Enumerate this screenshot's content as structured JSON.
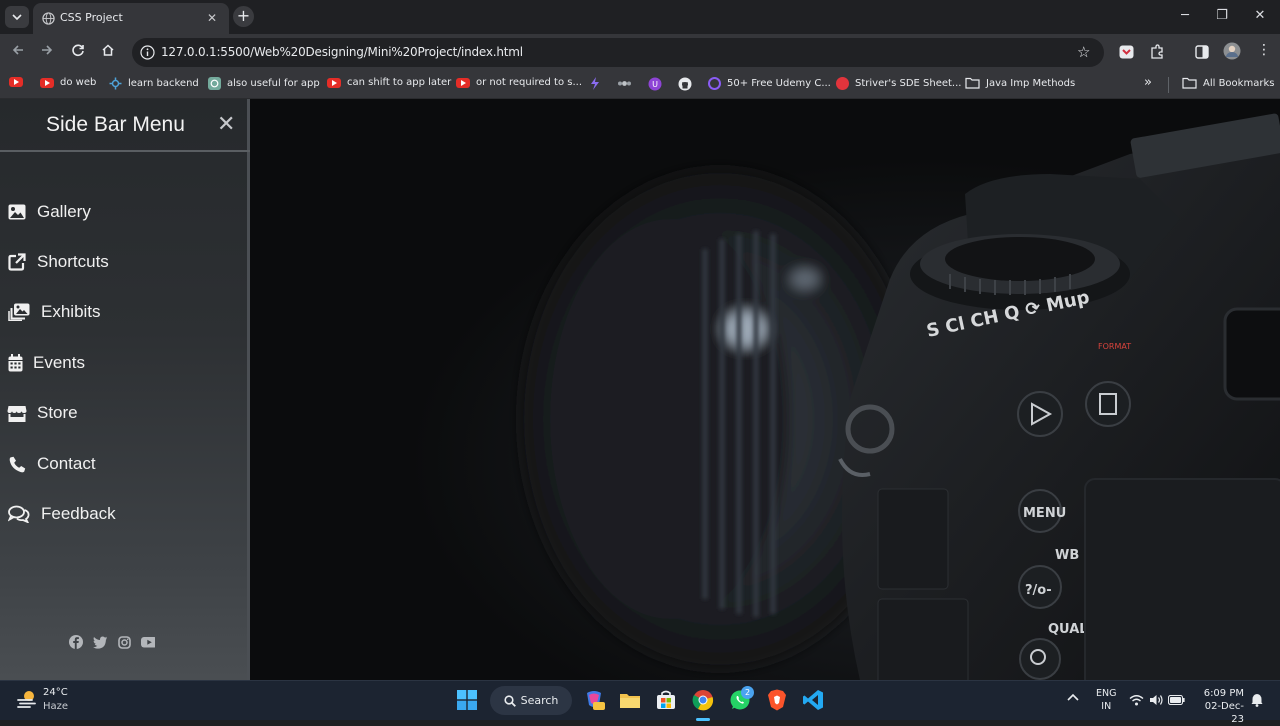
{
  "browser": {
    "tab_title": "CSS Project",
    "url": "127.0.0.1:5500/Web%20Designing/Mini%20Project/index.html"
  },
  "bookmarks": {
    "items": [
      {
        "label": "",
        "icon": "youtube-icon"
      },
      {
        "label": "do web",
        "icon": "youtube-icon"
      },
      {
        "label": "learn backend",
        "icon": "gear-icon"
      },
      {
        "label": "also useful for app",
        "icon": "chatgpt-icon"
      },
      {
        "label": "can shift to app later",
        "icon": "youtube-icon"
      },
      {
        "label": "or not required to s...",
        "icon": "youtube-icon"
      },
      {
        "label": "50+ Free Udemy C...",
        "icon": "udemy-icon"
      },
      {
        "label": "Striver's SDE Sheet...",
        "icon": "striver-icon"
      },
      {
        "label": "Java Imp Methods",
        "icon": "folder-icon"
      }
    ],
    "all_bookmarks": "All Bookmarks"
  },
  "sidebar": {
    "title": "Side Bar Menu",
    "items": [
      {
        "label": "Gallery",
        "icon": "image-icon"
      },
      {
        "label": "Shortcuts",
        "icon": "external-link-icon"
      },
      {
        "label": "Exhibits",
        "icon": "images-icon"
      },
      {
        "label": "Events",
        "icon": "calendar-icon"
      },
      {
        "label": "Store",
        "icon": "store-icon"
      },
      {
        "label": "Contact",
        "icon": "phone-icon"
      },
      {
        "label": "Feedback",
        "icon": "comments-icon"
      }
    ],
    "socials": [
      "facebook-icon",
      "twitter-icon",
      "instagram-icon",
      "youtube-icon"
    ]
  },
  "camera_labels": {
    "dial": "S  Cl  CH  Q  ⟳  Mup",
    "format": "FORMAT",
    "menu": "MENU",
    "wb": "WB",
    "qual": "QUAL",
    "key": "?/o-"
  },
  "taskbar": {
    "weather_temp": "24°C",
    "weather_desc": "Haze",
    "search": "Search",
    "lang_1": "ENG",
    "lang_2": "IN",
    "time": "6:09 PM",
    "date": "02-Dec-23",
    "whatsapp_badge": "2"
  }
}
